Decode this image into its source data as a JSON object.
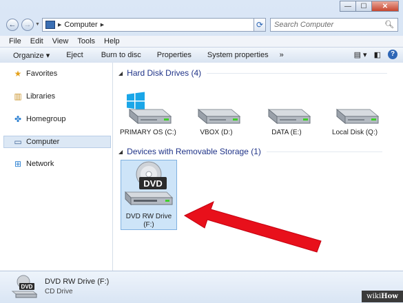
{
  "window": {
    "minimize": "—",
    "maximize": "☐",
    "close": "✕"
  },
  "nav": {
    "back": "←",
    "forward": "→",
    "path": "Computer",
    "search_placeholder": "Search Computer"
  },
  "menu": [
    "File",
    "Edit",
    "View",
    "Tools",
    "Help"
  ],
  "toolbar": [
    "Organize ▾",
    "Eject",
    "Burn to disc",
    "Properties",
    "System properties",
    "»"
  ],
  "sidebar": [
    {
      "label": "Favorites",
      "icon": "star-icon"
    },
    {
      "label": "Libraries",
      "icon": "library-icon"
    },
    {
      "label": "Homegroup",
      "icon": "homegroup-icon"
    },
    {
      "label": "Computer",
      "icon": "computer-icon",
      "selected": true
    },
    {
      "label": "Network",
      "icon": "network-icon"
    }
  ],
  "groups": {
    "hdd": "Hard Disk Drives (4)",
    "removable": "Devices with Removable Storage (1)"
  },
  "drives": [
    {
      "label": "PRIMARY OS (C:)",
      "windows_logo": true
    },
    {
      "label": "VBOX (D:)"
    },
    {
      "label": "DATA (E:)"
    },
    {
      "label": "Local Disk (Q:)"
    }
  ],
  "dvd": {
    "label_line1": "DVD RW Drive",
    "label_line2": "(F:)",
    "badge": "DVD"
  },
  "status": {
    "name": "DVD RW Drive (F:)",
    "type": "CD Drive",
    "badge": "DVD"
  },
  "watermark": {
    "wiki": "wiki",
    "how": "How"
  },
  "colors": {
    "accent": "#1e3287",
    "arrow": "#e8101b"
  }
}
